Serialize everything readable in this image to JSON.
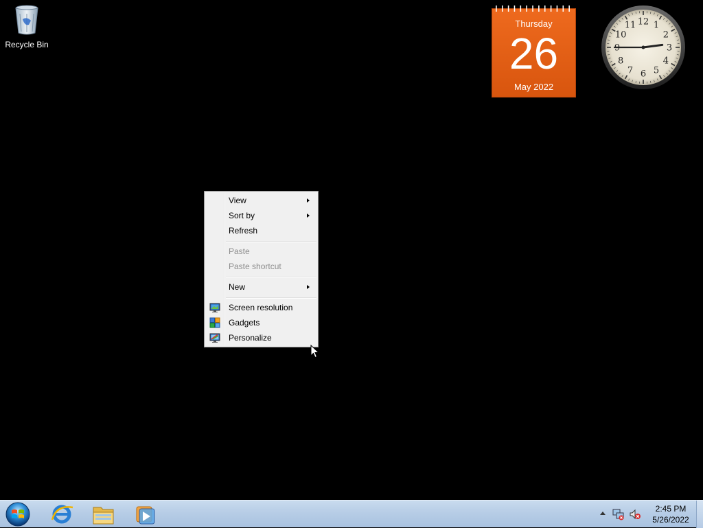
{
  "desktop": {
    "icons": [
      {
        "label": "Recycle Bin",
        "icon": "recycle-bin-icon"
      }
    ]
  },
  "calendar_gadget": {
    "weekday": "Thursday",
    "day": "26",
    "month_year": "May 2022",
    "color": "#e8631a"
  },
  "clock_gadget": {
    "numbers": [
      "12",
      "1",
      "2",
      "3",
      "4",
      "5",
      "6",
      "7",
      "8",
      "9",
      "10",
      "11"
    ],
    "time": "2:45"
  },
  "context_menu": {
    "items": [
      {
        "label": "View",
        "submenu": true,
        "enabled": true
      },
      {
        "label": "Sort by",
        "submenu": true,
        "enabled": true
      },
      {
        "label": "Refresh",
        "submenu": false,
        "enabled": true
      },
      {
        "label": "Paste",
        "submenu": false,
        "enabled": false
      },
      {
        "label": "Paste shortcut",
        "submenu": false,
        "enabled": false
      },
      {
        "label": "New",
        "submenu": true,
        "enabled": true
      },
      {
        "label": "Screen resolution",
        "submenu": false,
        "enabled": true,
        "icon": "screen-resolution-icon"
      },
      {
        "label": "Gadgets",
        "submenu": false,
        "enabled": true,
        "icon": "gadgets-icon"
      },
      {
        "label": "Personalize",
        "submenu": false,
        "enabled": true,
        "icon": "personalize-icon"
      }
    ]
  },
  "taskbar": {
    "pinned": [
      {
        "name": "internet-explorer-icon"
      },
      {
        "name": "windows-explorer-icon"
      },
      {
        "name": "media-player-icon"
      }
    ],
    "tray": {
      "time": "2:45 PM",
      "date": "5/26/2022"
    },
    "color": "#b7cde6"
  }
}
